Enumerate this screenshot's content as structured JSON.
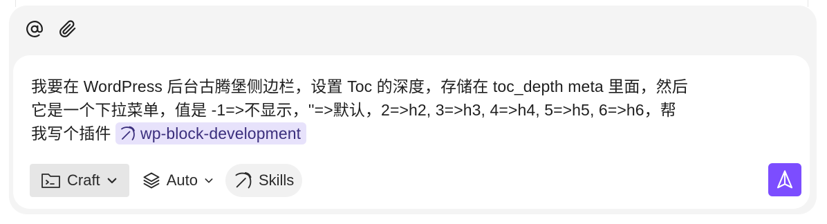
{
  "composer": {
    "attach_icons": [
      "at-icon",
      "paperclip-icon"
    ],
    "prompt_line_1": "我要在 WordPress 后台古腾堡侧边栏，设置 Toc 的深度，存储在 toc_depth meta 里面，然后",
    "prompt_line_2": "它是一个下拉菜单，值是 -1=>不显示，''=>默认，2=>h2, 3=>h3, 4=>h4, 5=>h5, 6=>h6，帮",
    "prompt_line_3": "我写个插件",
    "skill_chip": "wp-block-development",
    "toolbar": {
      "craft_label": "Craft",
      "auto_label": "Auto",
      "skills_label": "Skills"
    },
    "colors": {
      "accent": "#7c4dff",
      "chip_bg": "#e7e2fb"
    }
  }
}
